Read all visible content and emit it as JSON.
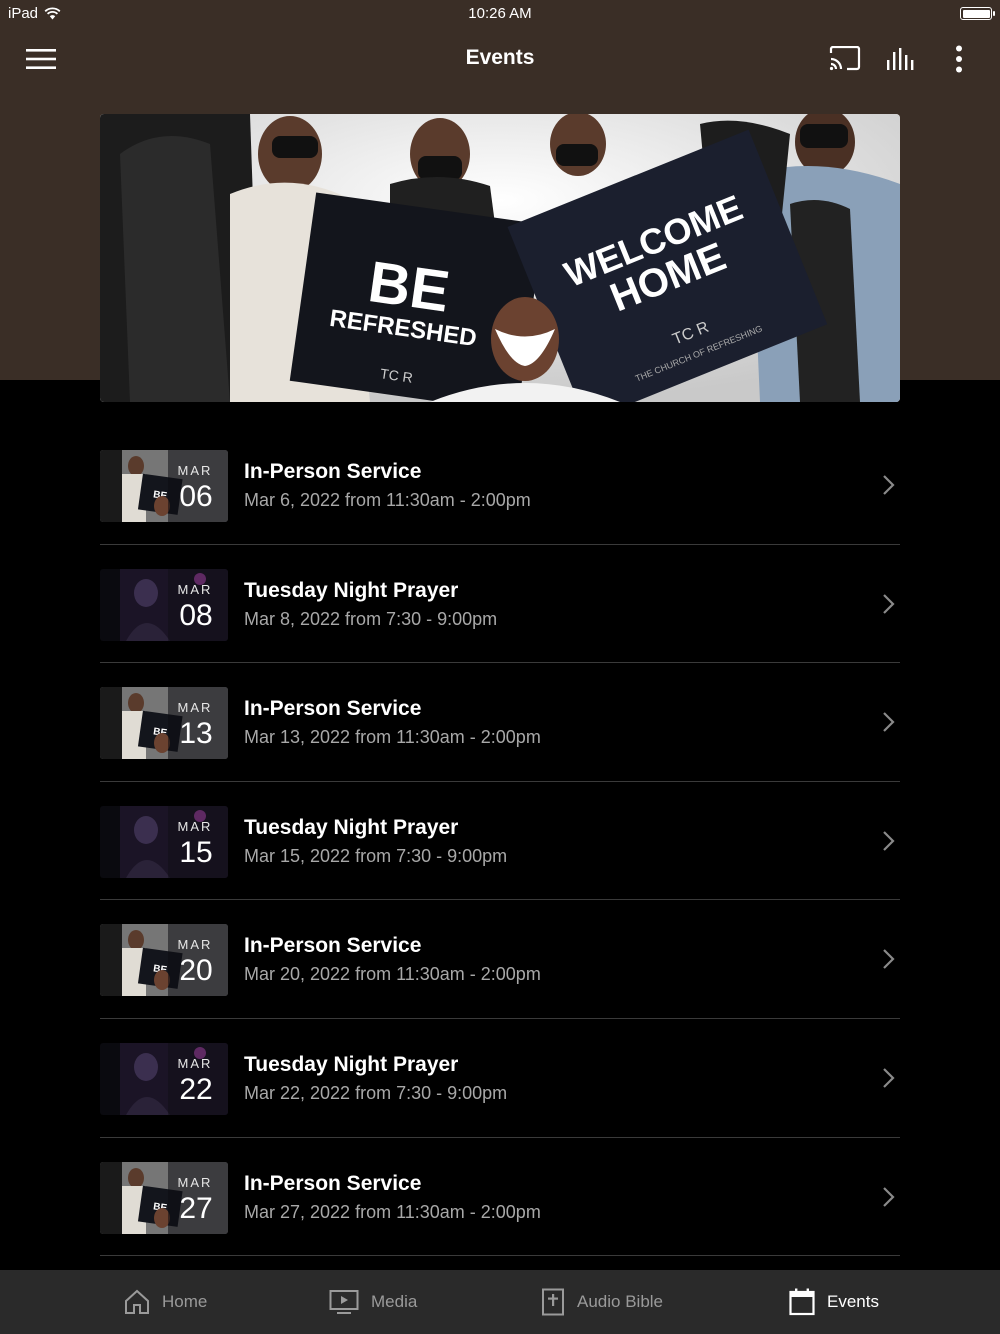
{
  "status": {
    "device": "iPad",
    "time": "10:26 AM"
  },
  "nav": {
    "title": "Events"
  },
  "hero": {
    "sign1_line1": "BE",
    "sign1_line2": "REFRESHED",
    "sign2_line1": "WELCOME",
    "sign2_line2": "HOME",
    "logo": "TC R",
    "logo_sub": "THE CHURCH OF REFRESHING"
  },
  "events": [
    {
      "month": "MAR",
      "day": "06",
      "title": "In-Person Service",
      "subtitle": "Mar 6, 2022 from 11:30am - 2:00pm",
      "thumb": "service"
    },
    {
      "month": "MAR",
      "day": "08",
      "title": "Tuesday Night Prayer",
      "subtitle": "Mar 8, 2022 from 7:30 - 9:00pm",
      "thumb": "prayer"
    },
    {
      "month": "MAR",
      "day": "13",
      "title": "In-Person Service",
      "subtitle": "Mar 13, 2022 from 11:30am - 2:00pm",
      "thumb": "service"
    },
    {
      "month": "MAR",
      "day": "15",
      "title": "Tuesday Night Prayer",
      "subtitle": "Mar 15, 2022 from 7:30 - 9:00pm",
      "thumb": "prayer"
    },
    {
      "month": "MAR",
      "day": "20",
      "title": "In-Person Service",
      "subtitle": "Mar 20, 2022 from 11:30am - 2:00pm",
      "thumb": "service"
    },
    {
      "month": "MAR",
      "day": "22",
      "title": "Tuesday Night Prayer",
      "subtitle": "Mar 22, 2022 from 7:30 - 9:00pm",
      "thumb": "prayer"
    },
    {
      "month": "MAR",
      "day": "27",
      "title": "In-Person Service",
      "subtitle": "Mar 27, 2022 from 11:30am - 2:00pm",
      "thumb": "service"
    }
  ],
  "tabs": [
    {
      "label": "Home",
      "icon": "home-icon",
      "active": false
    },
    {
      "label": "Media",
      "icon": "tv-icon",
      "active": false
    },
    {
      "label": "Audio Bible",
      "icon": "bible-icon",
      "active": false
    },
    {
      "label": "Events",
      "icon": "calendar-icon",
      "active": true
    }
  ],
  "colors": {
    "header_bg": "#3a2e26",
    "tab_bar_bg": "#2a2a2a",
    "subtitle": "#a8a8a8"
  }
}
